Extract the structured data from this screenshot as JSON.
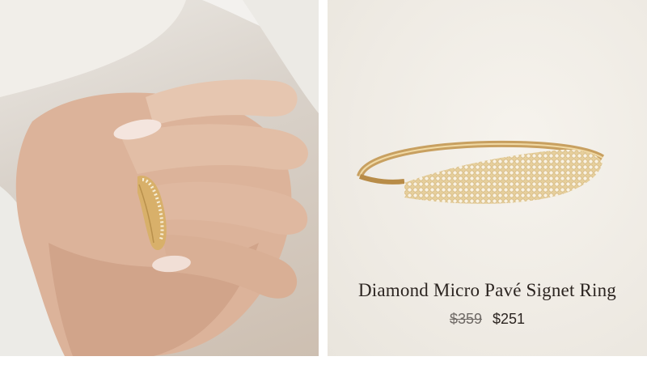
{
  "lifestyle_photo": {
    "alt": "hand wearing ring"
  },
  "product": {
    "image_alt": "ring",
    "title": "Diamond Micro Pavé Signet Ring",
    "price_original": "$359",
    "price_sale": "$251"
  }
}
